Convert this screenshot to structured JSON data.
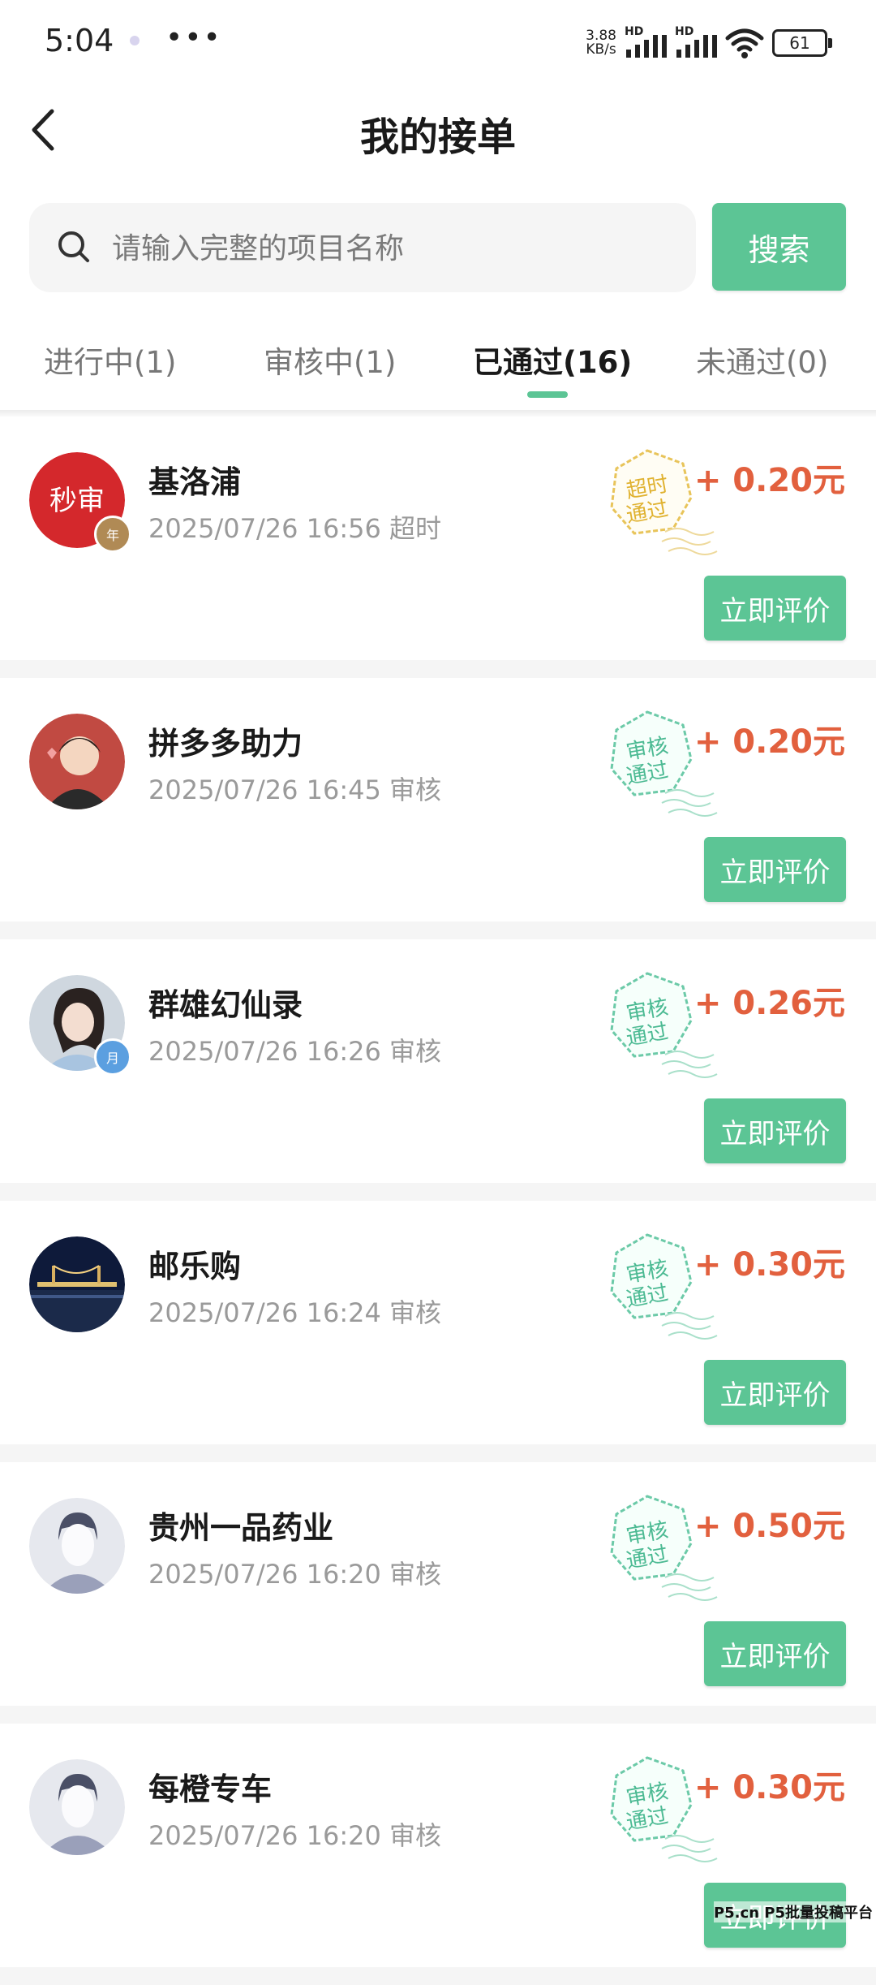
{
  "status_bar": {
    "time": "5:04",
    "net_speed_value": "3.88",
    "net_speed_unit": "KB/s",
    "signal1_label": "HD",
    "signal2_label": "HD",
    "battery": "61"
  },
  "header": {
    "title": "我的接单",
    "back_icon": "chevron-left-icon"
  },
  "search": {
    "placeholder": "请输入完整的项目名称",
    "value": "",
    "button_label": "搜索"
  },
  "tabs": [
    {
      "label": "进行中(1)",
      "active": false
    },
    {
      "label": "审核中(1)",
      "active": false
    },
    {
      "label": "已通过(16)",
      "active": true
    },
    {
      "label": "未通过(0)",
      "active": false
    }
  ],
  "colors": {
    "accent": "#5cc595",
    "amount": "#e2603e",
    "stamp_timeout": "#e8c45a",
    "stamp_review": "#6ccaa8"
  },
  "orders": [
    {
      "name": "基洛浦",
      "datetime": "2025/07/26 16:56",
      "status": "超时",
      "stamp": [
        "超时",
        "通过"
      ],
      "amount": "+ 0.20元",
      "action": "立即评价",
      "avatar_text": "秒审",
      "badge": "年"
    },
    {
      "name": "拼多多助力",
      "datetime": "2025/07/26 16:45",
      "status": "审核",
      "stamp": [
        "审核",
        "通过"
      ],
      "amount": "+ 0.20元",
      "action": "立即评价"
    },
    {
      "name": "群雄幻仙录",
      "datetime": "2025/07/26 16:26",
      "status": "审核",
      "stamp": [
        "审核",
        "通过"
      ],
      "amount": "+ 0.26元",
      "action": "立即评价",
      "badge": "月"
    },
    {
      "name": "邮乐购",
      "datetime": "2025/07/26 16:24",
      "status": "审核",
      "stamp": [
        "审核",
        "通过"
      ],
      "amount": "+ 0.30元",
      "action": "立即评价"
    },
    {
      "name": "贵州一品药业",
      "datetime": "2025/07/26 16:20",
      "status": "审核",
      "stamp": [
        "审核",
        "通过"
      ],
      "amount": "+ 0.50元",
      "action": "立即评价"
    },
    {
      "name": "每橙专车",
      "datetime": "2025/07/26 16:20",
      "status": "审核",
      "stamp": [
        "审核",
        "通过"
      ],
      "amount": "+ 0.30元",
      "action": "立即评价"
    }
  ],
  "watermark": "P5.cn P5批量投稿平台"
}
